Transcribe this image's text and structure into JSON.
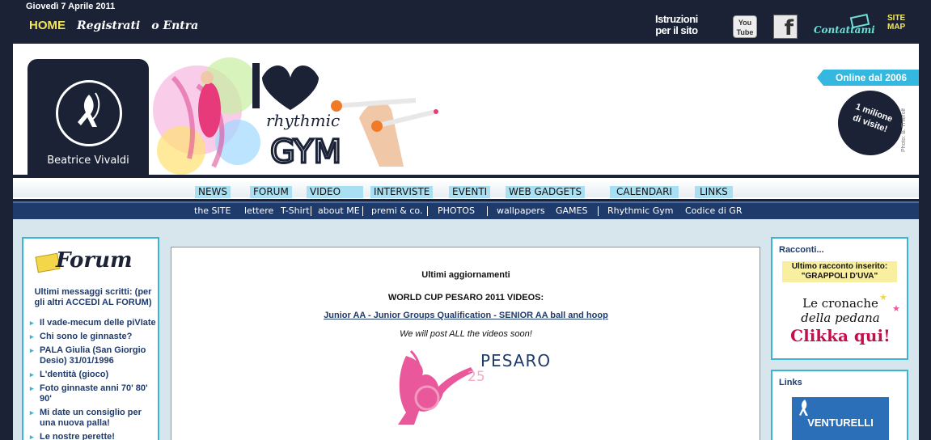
{
  "topbar": {
    "date": "Giovedì 7 Aprile 2011",
    "home": "HOME",
    "registrati": "Registrati",
    "entra": "o Entra",
    "istruzioni_line1": "Istruzioni",
    "istruzioni_line2": "per il sito",
    "youtube_label": "You Tube",
    "facebook_label": "f",
    "contattami": "Contattami",
    "sitemap_line1": "SITE",
    "sitemap_line2": "MAP"
  },
  "banner": {
    "brand_name": "Beatrice Vivaldi",
    "online_since": "Online dal 2006",
    "milione_line1": "1 milione",
    "milione_line2": "di visite!",
    "photo_credit": "Photo: B. Thierolf",
    "art_heart_text": "I",
    "art_rhythmic": "rhythmic",
    "art_gym": "GYM"
  },
  "nav_main": [
    "NEWS",
    "FORUM",
    "VIDEO",
    "INTERVISTE",
    "EVENTI",
    "WEB GADGETS",
    "CALENDARI",
    "LINKS"
  ],
  "nav_sub": [
    "the SITE",
    "lettere",
    "T-Shirt",
    "about ME",
    "premi & co.",
    "PHOTOS",
    "wallpapers",
    "GAMES",
    "Rhythmic Gym",
    "Codice di GR"
  ],
  "forum": {
    "title": "Forum",
    "intro": "Ultimi messaggi scritti: (per gli altri ACCEDI AL FORUM)",
    "posts": [
      "Il vade-mecum delle piVIate",
      "Chi sono le ginnaste?",
      "PALA Giulia (San Giorgio Desio) 31/01/1996",
      "L'dentità (gioco)",
      "Foto ginnaste anni 70' 80' 90'",
      "Mi date un consiglio per una nuova palla!",
      "Le nostre perette!"
    ]
  },
  "main": {
    "title": "Ultimi aggiornamenti",
    "worldcup": "WORLD CUP PESARO 2011 VIDEOS:",
    "link": "Junior AA - Junior Groups Qualification - SENIOR AA ball and hoop",
    "note": "We will post ALL the videos soon!",
    "logo_word": "PESARO",
    "logo_number": "25"
  },
  "racconti": {
    "heading": "Racconti...",
    "highlight_line1": "Ultimo racconto inserito:",
    "highlight_line2": "\"GRAPPOLI D'UVA\"",
    "cronache_line1": "Le cronache",
    "cronache_line2": "della pedana",
    "cta": "Clikka qui!"
  },
  "links": {
    "heading": "Links",
    "sponsor": "VENTURELLI"
  },
  "colors": {
    "dark_navy": "#1b2236",
    "accent_cyan": "#3ab5d8",
    "nav_highlight": "#a8dff2",
    "home_yellow": "#f4e85a",
    "cta_red": "#c4104a"
  }
}
